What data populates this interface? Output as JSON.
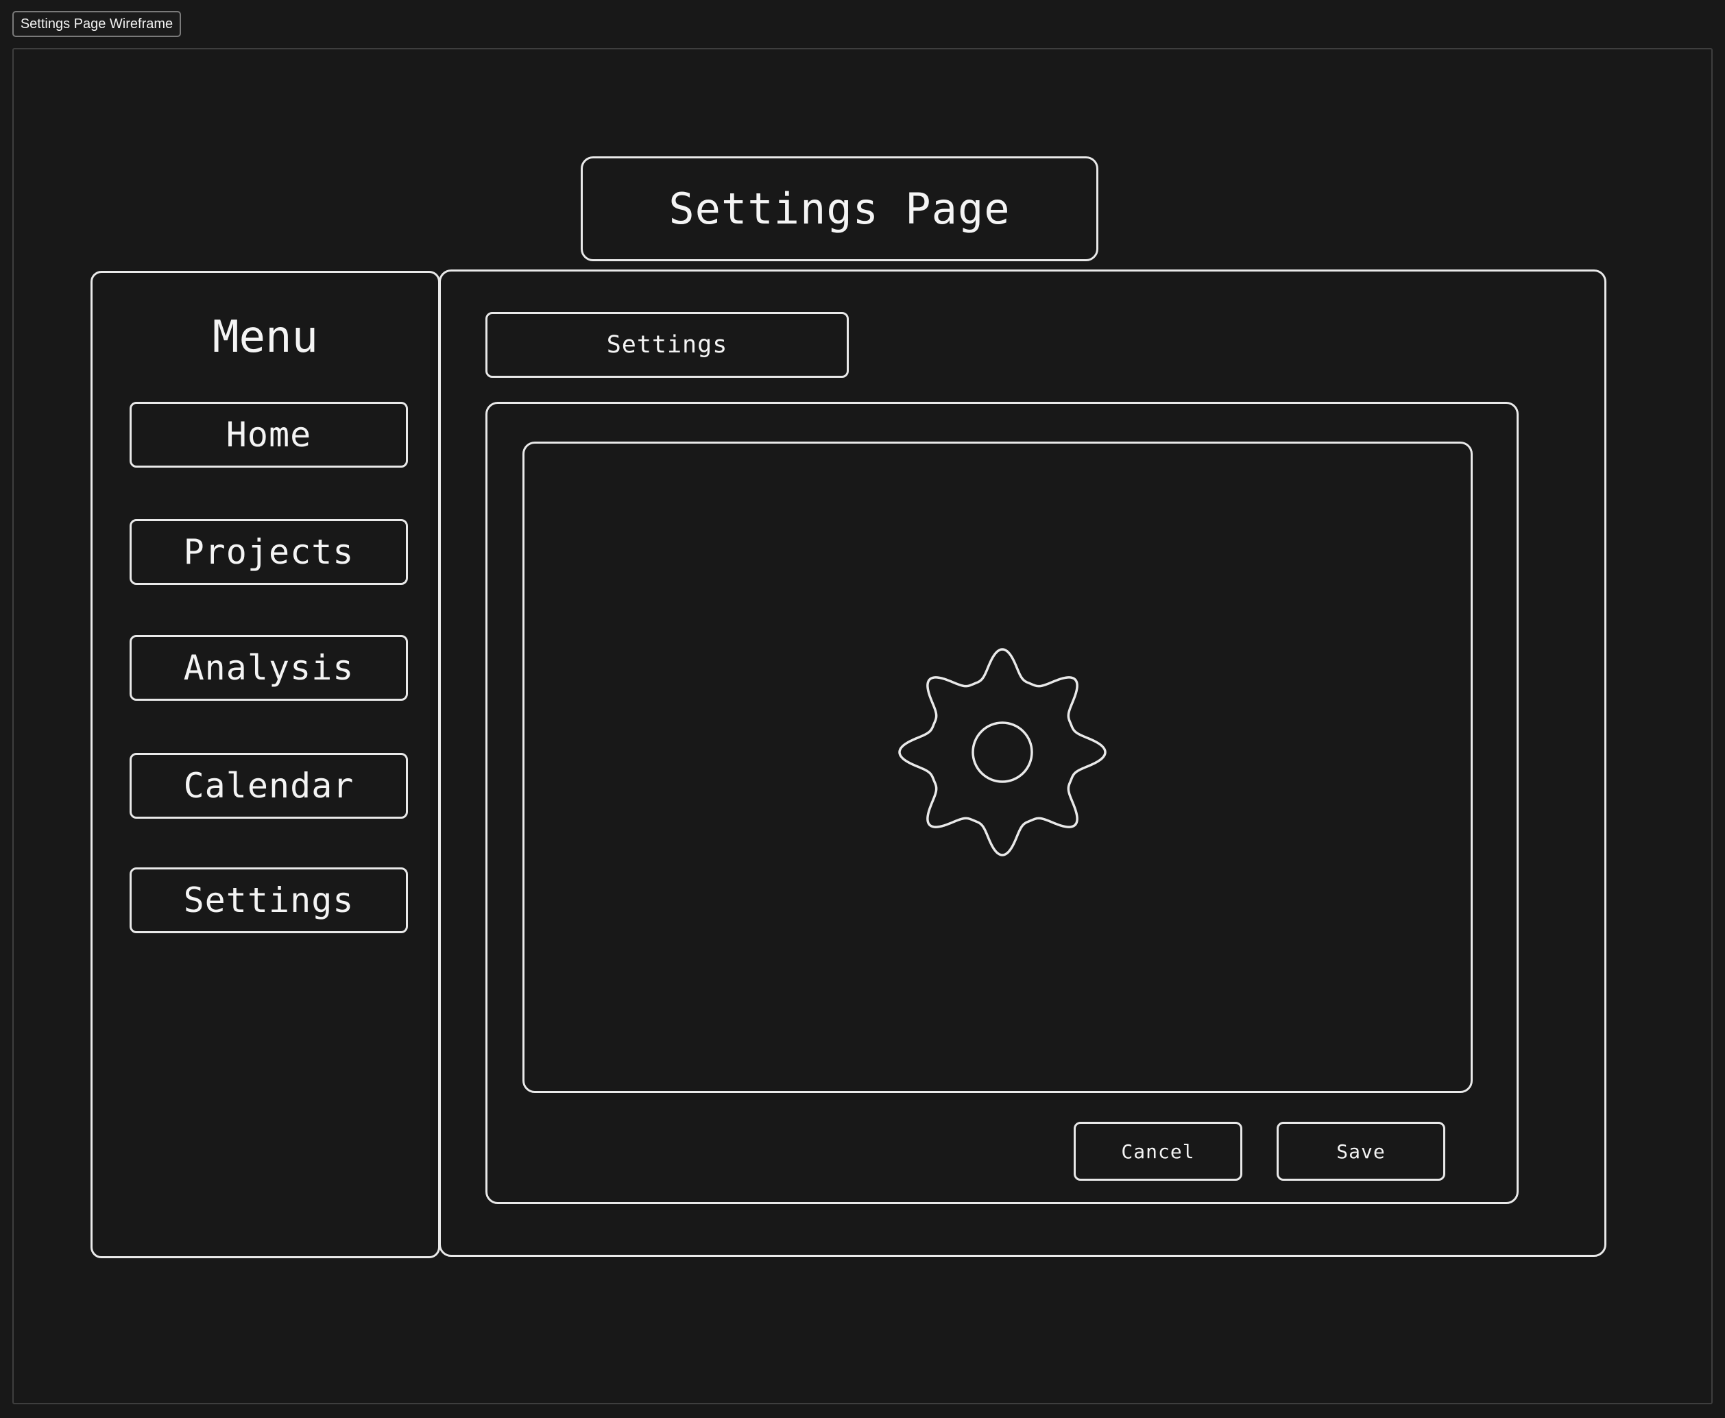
{
  "frame": {
    "label": "Settings Page Wireframe"
  },
  "header": {
    "title": "Settings Page"
  },
  "sidebar": {
    "title": "Menu",
    "items": [
      {
        "label": "Home"
      },
      {
        "label": "Projects"
      },
      {
        "label": "Analysis"
      },
      {
        "label": "Calendar"
      },
      {
        "label": "Settings"
      }
    ]
  },
  "main": {
    "tab_label": "Settings",
    "icon": "gear-icon",
    "actions": {
      "cancel_label": "Cancel",
      "save_label": "Save"
    }
  },
  "colors": {
    "background": "#181818",
    "stroke": "#e9e9e9",
    "text": "#f4f4f4",
    "frame_border": "#3e3e3e"
  }
}
